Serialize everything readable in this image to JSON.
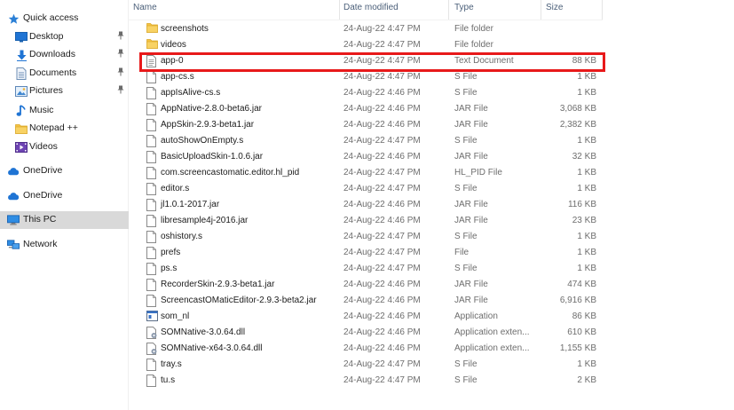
{
  "nav": {
    "items": [
      {
        "label": "Quick access",
        "icon": "star-icon",
        "pinned": false
      },
      {
        "label": "Desktop",
        "icon": "desktop-icon",
        "pinned": true
      },
      {
        "label": "Downloads",
        "icon": "download-arrow-icon",
        "pinned": true
      },
      {
        "label": "Documents",
        "icon": "documents-icon",
        "pinned": true
      },
      {
        "label": "Pictures",
        "icon": "pictures-icon",
        "pinned": true
      },
      {
        "label": "Music",
        "icon": "music-note-icon",
        "pinned": false
      },
      {
        "label": "Notepad ++",
        "icon": "folder-icon",
        "pinned": false
      },
      {
        "label": "Videos",
        "icon": "videos-icon",
        "pinned": false
      },
      {
        "label": "OneDrive",
        "icon": "cloud-icon",
        "pinned": false
      },
      {
        "label": "OneDrive",
        "icon": "cloud-icon",
        "pinned": false
      },
      {
        "label": "This PC",
        "icon": "computer-icon",
        "pinned": false,
        "selected": true
      },
      {
        "label": "Network",
        "icon": "network-icon",
        "pinned": false
      }
    ],
    "pin_glyph": "📌"
  },
  "list": {
    "columns": {
      "name": "Name",
      "date": "Date modified",
      "type": "Type",
      "size": "Size"
    },
    "files": [
      {
        "name": "screenshots",
        "date": "24-Aug-22 4:47 PM",
        "type": "File folder",
        "size": "",
        "icon": "folder"
      },
      {
        "name": "videos",
        "date": "24-Aug-22 4:47 PM",
        "type": "File folder",
        "size": "",
        "icon": "folder"
      },
      {
        "name": "app-0",
        "date": "24-Aug-22 4:47 PM",
        "type": "Text Document",
        "size": "88 KB",
        "icon": "text"
      },
      {
        "name": "app-cs.s",
        "date": "24-Aug-22 4:47 PM",
        "type": "S File",
        "size": "1 KB",
        "icon": "file"
      },
      {
        "name": "appIsAlive-cs.s",
        "date": "24-Aug-22 4:46 PM",
        "type": "S File",
        "size": "1 KB",
        "icon": "file"
      },
      {
        "name": "AppNative-2.8.0-beta6.jar",
        "date": "24-Aug-22 4:46 PM",
        "type": "JAR File",
        "size": "3,068 KB",
        "icon": "file"
      },
      {
        "name": "AppSkin-2.9.3-beta1.jar",
        "date": "24-Aug-22 4:46 PM",
        "type": "JAR File",
        "size": "2,382 KB",
        "icon": "file"
      },
      {
        "name": "autoShowOnEmpty.s",
        "date": "24-Aug-22 4:47 PM",
        "type": "S File",
        "size": "1 KB",
        "icon": "file"
      },
      {
        "name": "BasicUploadSkin-1.0.6.jar",
        "date": "24-Aug-22 4:46 PM",
        "type": "JAR File",
        "size": "32 KB",
        "icon": "file"
      },
      {
        "name": "com.screencastomatic.editor.hl_pid",
        "date": "24-Aug-22 4:47 PM",
        "type": "HL_PID File",
        "size": "1 KB",
        "icon": "file"
      },
      {
        "name": "editor.s",
        "date": "24-Aug-22 4:47 PM",
        "type": "S File",
        "size": "1 KB",
        "icon": "file"
      },
      {
        "name": "jl1.0.1-2017.jar",
        "date": "24-Aug-22 4:46 PM",
        "type": "JAR File",
        "size": "116 KB",
        "icon": "file"
      },
      {
        "name": "libresample4j-2016.jar",
        "date": "24-Aug-22 4:46 PM",
        "type": "JAR File",
        "size": "23 KB",
        "icon": "file"
      },
      {
        "name": "oshistory.s",
        "date": "24-Aug-22 4:47 PM",
        "type": "S File",
        "size": "1 KB",
        "icon": "file"
      },
      {
        "name": "prefs",
        "date": "24-Aug-22 4:47 PM",
        "type": "File",
        "size": "1 KB",
        "icon": "file"
      },
      {
        "name": "ps.s",
        "date": "24-Aug-22 4:47 PM",
        "type": "S File",
        "size": "1 KB",
        "icon": "file"
      },
      {
        "name": "RecorderSkin-2.9.3-beta1.jar",
        "date": "24-Aug-22 4:46 PM",
        "type": "JAR File",
        "size": "474 KB",
        "icon": "file"
      },
      {
        "name": "ScreencastOMaticEditor-2.9.3-beta2.jar",
        "date": "24-Aug-22 4:46 PM",
        "type": "JAR File",
        "size": "6,916 KB",
        "icon": "file"
      },
      {
        "name": "som_nl",
        "date": "24-Aug-22 4:46 PM",
        "type": "Application",
        "size": "86 KB",
        "icon": "app"
      },
      {
        "name": "SOMNative-3.0.64.dll",
        "date": "24-Aug-22 4:46 PM",
        "type": "Application exten...",
        "size": "610 KB",
        "icon": "dll"
      },
      {
        "name": "SOMNative-x64-3.0.64.dll",
        "date": "24-Aug-22 4:46 PM",
        "type": "Application exten...",
        "size": "1,155 KB",
        "icon": "dll"
      },
      {
        "name": "tray.s",
        "date": "24-Aug-22 4:47 PM",
        "type": "S File",
        "size": "1 KB",
        "icon": "file"
      },
      {
        "name": "tu.s",
        "date": "24-Aug-22 4:47 PM",
        "type": "S File",
        "size": "2 KB",
        "icon": "file"
      }
    ]
  },
  "colors": {
    "highlight": "#e8191a",
    "selected_nav": "#d9d9d9",
    "folder": "#f5c342",
    "accent": "#1f74d4"
  }
}
